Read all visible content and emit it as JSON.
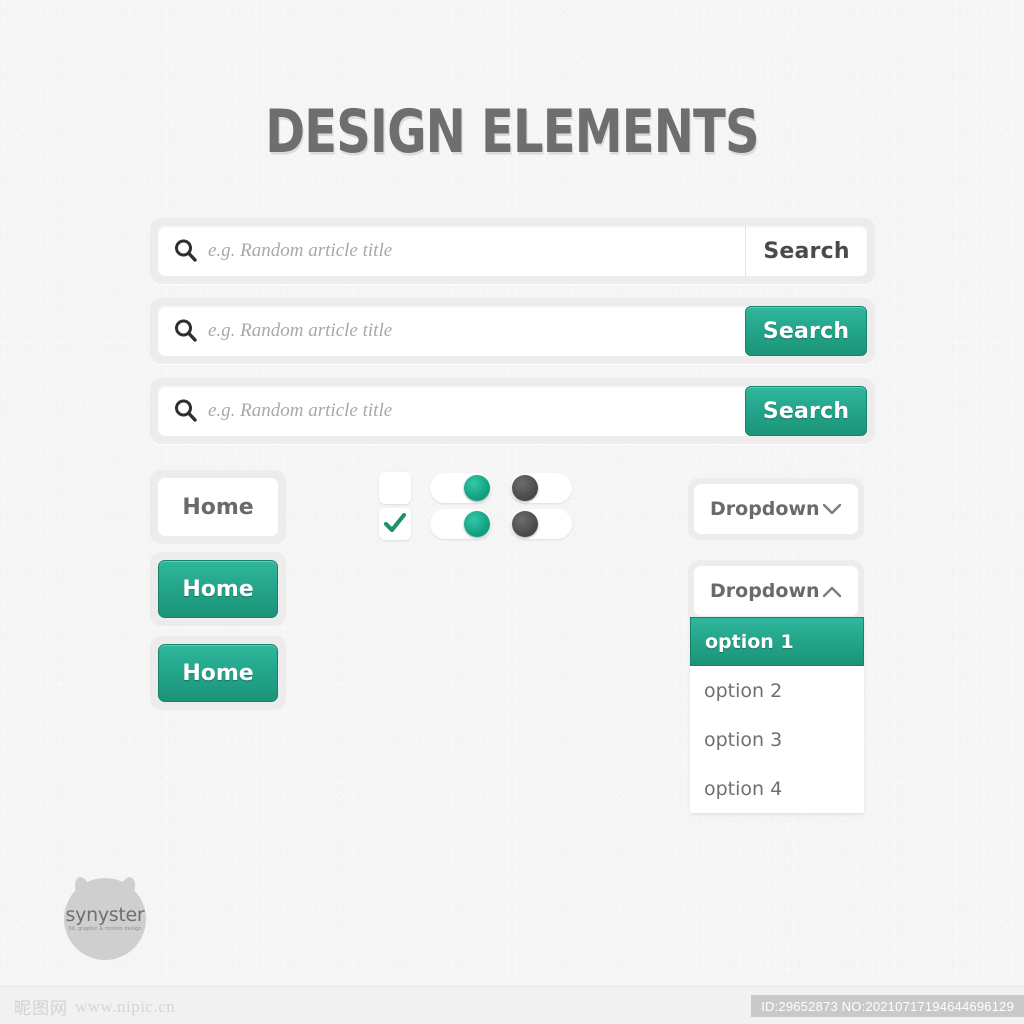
{
  "page": {
    "title": "DESIGN ELEMENTS",
    "accent_color": "#23a489",
    "background_color": "#f6f6f6",
    "text_color": "#6a6a6a"
  },
  "search_bars": [
    {
      "icon": "search-icon",
      "placeholder": "e.g. Random article title",
      "value": "",
      "button_label": "Search",
      "button_style": "plain"
    },
    {
      "icon": "search-icon",
      "placeholder": "e.g. Random article title",
      "value": "",
      "button_label": "Search",
      "button_style": "teal"
    },
    {
      "icon": "search-icon",
      "placeholder": "e.g. Random article title",
      "value": "",
      "button_label": "Search",
      "button_style": "teal"
    }
  ],
  "buttons": [
    {
      "label": "Home",
      "style": "light"
    },
    {
      "label": "Home",
      "style": "teal"
    },
    {
      "label": "Home",
      "style": "teal"
    }
  ],
  "checkboxes": [
    {
      "checked": false,
      "icon": "checkbox-empty-icon"
    },
    {
      "checked": true,
      "icon": "check-icon"
    }
  ],
  "toggles": [
    {
      "state": "on",
      "color": "#12a383"
    },
    {
      "state": "on",
      "color": "#12a383"
    },
    {
      "state": "off",
      "color": "#4d4d4d"
    },
    {
      "state": "off",
      "color": "#4d4d4d"
    }
  ],
  "dropdown_closed": {
    "label": "Dropdown",
    "chevron": "chevron-down-icon",
    "expanded": false
  },
  "dropdown_open": {
    "label": "Dropdown",
    "chevron": "chevron-up-icon",
    "expanded": true,
    "options": [
      {
        "label": "option 1",
        "selected": true
      },
      {
        "label": "option 2",
        "selected": false
      },
      {
        "label": "option 3",
        "selected": false
      },
      {
        "label": "option 4",
        "selected": false
      }
    ]
  },
  "logo": {
    "name": "synyster",
    "tagline": "3d, graphic & motion design"
  },
  "footer": {
    "watermark_cn": "昵图网",
    "watermark_url": "www.nipic.cn",
    "id_text": "ID:29652873 NO:20210717194644696129"
  }
}
